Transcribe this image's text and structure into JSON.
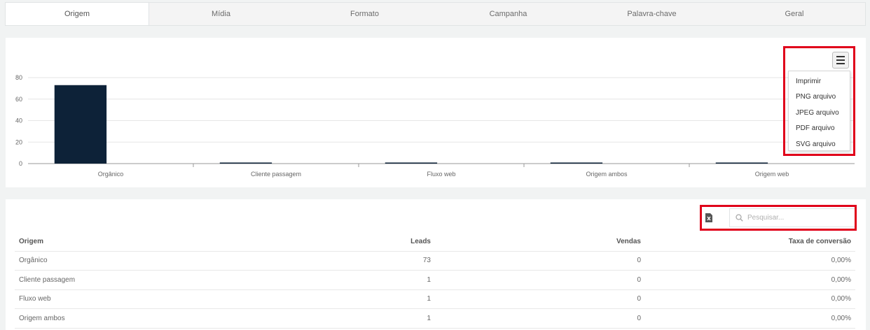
{
  "tabs": [
    {
      "label": "Origem",
      "active": true
    },
    {
      "label": "Mídia",
      "active": false
    },
    {
      "label": "Formato",
      "active": false
    },
    {
      "label": "Campanha",
      "active": false
    },
    {
      "label": "Palavra-chave",
      "active": false
    },
    {
      "label": "Geral",
      "active": false
    }
  ],
  "chart_data": {
    "type": "bar",
    "categories": [
      "Orgânico",
      "Cliente passagem",
      "Fluxo web",
      "Origem ambos",
      "Origem web"
    ],
    "values": [
      73,
      1,
      1,
      1,
      1
    ],
    "ylim": [
      0,
      80
    ],
    "yticks": [
      "0",
      "20",
      "40",
      "60",
      "80"
    ],
    "grid": true,
    "colors": {
      "bar": "#0d2238"
    }
  },
  "export_menu": {
    "items": [
      "Imprimir",
      "PNG arquivo",
      "JPEG arquivo",
      "PDF arquivo",
      "SVG arquivo"
    ]
  },
  "search": {
    "placeholder": "Pesquisar..."
  },
  "table": {
    "headers": [
      "Origem",
      "Leads",
      "Vendas",
      "Taxa de conversão"
    ],
    "rows": [
      [
        "Orgânico",
        "73",
        "0",
        "0,00%"
      ],
      [
        "Cliente passagem",
        "1",
        "0",
        "0,00%"
      ],
      [
        "Fluxo web",
        "1",
        "0",
        "0,00%"
      ],
      [
        "Origem ambos",
        "1",
        "0",
        "0,00%"
      ]
    ]
  }
}
